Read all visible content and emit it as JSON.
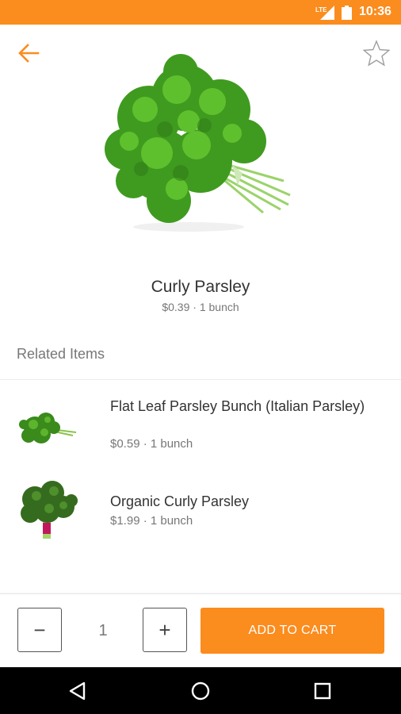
{
  "status_bar": {
    "network": "LTE",
    "time": "10:36"
  },
  "colors": {
    "accent": "#fb8c1e",
    "text": "#333333",
    "muted": "#777777"
  },
  "header": {
    "back_icon": "arrow-left-icon",
    "favorite_icon": "star-outline-icon"
  },
  "product": {
    "name": "Curly Parsley",
    "meta": "$0.39 · 1 bunch"
  },
  "related": {
    "title": "Related Items",
    "items": [
      {
        "name": "Flat Leaf Parsley Bunch (Italian Parsley)",
        "meta": "$0.59 · 1 bunch"
      },
      {
        "name": "Organic Curly Parsley",
        "meta": "$1.99 · 1 bunch"
      }
    ]
  },
  "cart": {
    "minus_label": "−",
    "quantity": "1",
    "plus_label": "+",
    "add_label": "ADD TO CART"
  },
  "nav_bar": {
    "back_icon": "triangle-back-icon",
    "home_icon": "circle-home-icon",
    "recents_icon": "square-recents-icon"
  }
}
